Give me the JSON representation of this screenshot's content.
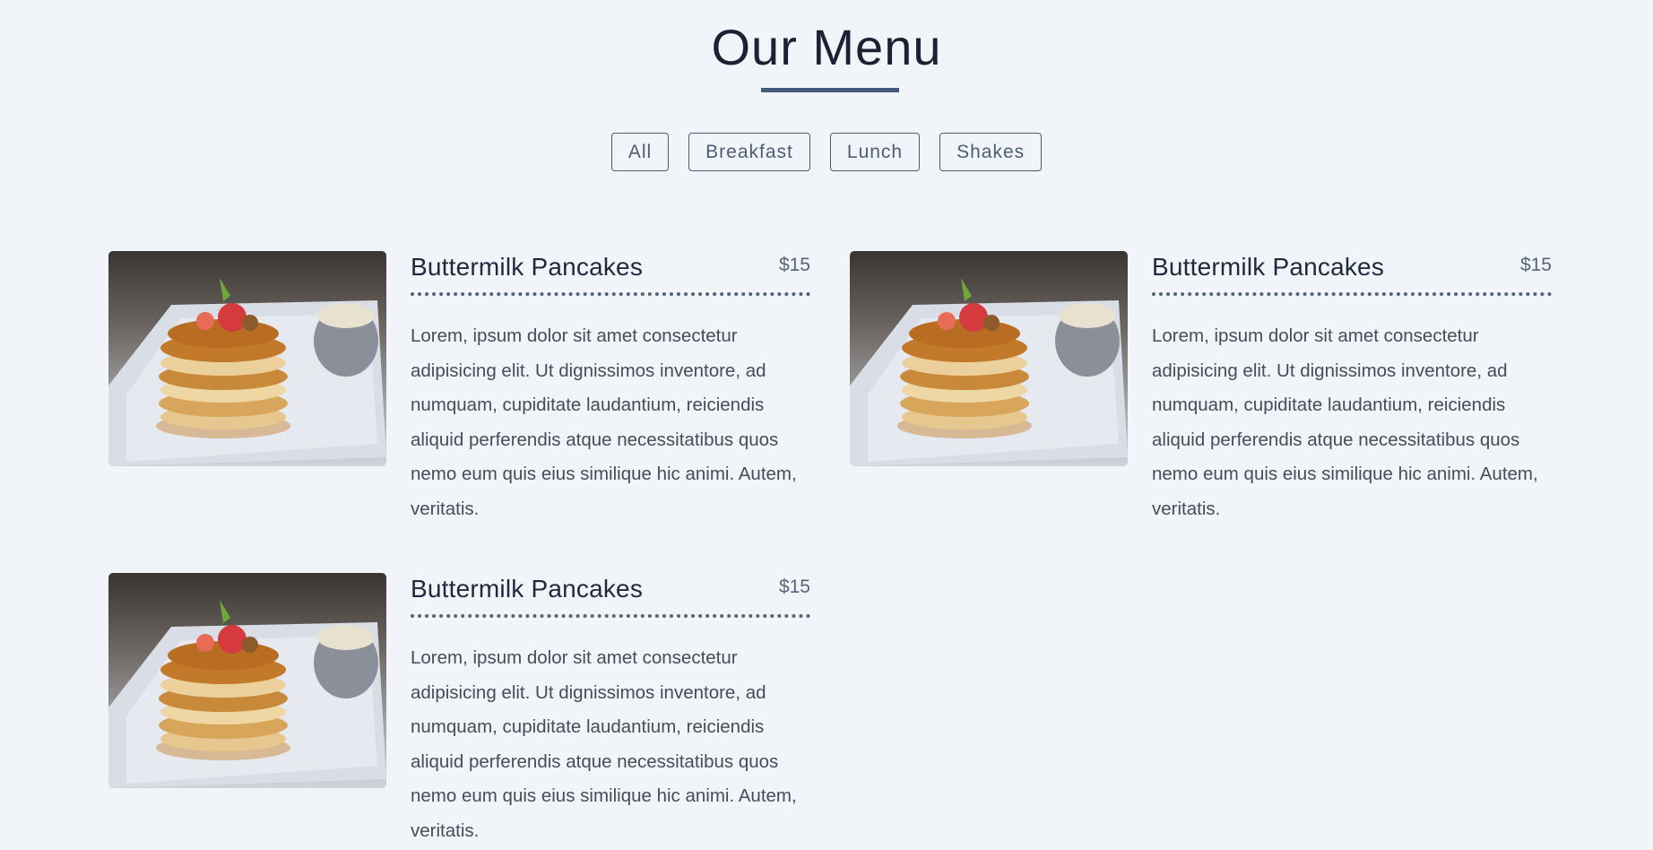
{
  "header": {
    "title": "Our Menu"
  },
  "filters": [
    {
      "label": "All"
    },
    {
      "label": "Breakfast"
    },
    {
      "label": "Lunch"
    },
    {
      "label": "Shakes"
    }
  ],
  "menu_items": [
    {
      "name": "Buttermilk Pancakes",
      "price": "$15",
      "description": "Lorem, ipsum dolor sit amet consectetur adipisicing elit. Ut dignissimos inventore, ad numquam, cupiditate laudantium, reiciendis aliquid perferendis atque necessitatibus quos nemo eum quis eius similique hic animi. Autem, veritatis."
    },
    {
      "name": "Buttermilk Pancakes",
      "price": "$15",
      "description": "Lorem, ipsum dolor sit amet consectetur adipisicing elit. Ut dignissimos inventore, ad numquam, cupiditate laudantium, reiciendis aliquid perferendis atque necessitatibus quos nemo eum quis eius similique hic animi. Autem, veritatis."
    },
    {
      "name": "Buttermilk Pancakes",
      "price": "$15",
      "description": "Lorem, ipsum dolor sit amet consectetur adipisicing elit. Ut dignissimos inventore, ad numquam, cupiditate laudantium, reiciendis aliquid perferendis atque necessitatibus quos nemo eum quis eius similique hic animi. Autem, veritatis."
    }
  ],
  "colors": {
    "background": "#f1f4f9",
    "accent": "#445b7e"
  }
}
